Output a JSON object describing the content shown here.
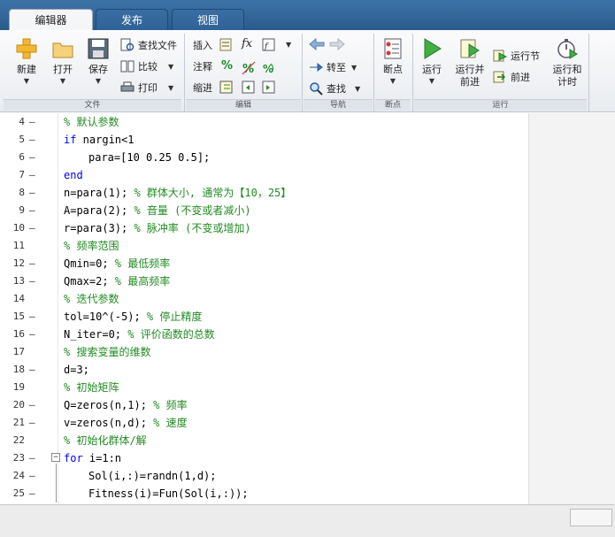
{
  "tabs": [
    {
      "label": "编辑器"
    },
    {
      "label": "发布"
    },
    {
      "label": "视图"
    }
  ],
  "toolstrip": {
    "file": {
      "section_label": "文件",
      "new_label": "新建",
      "open_label": "打开",
      "save_label": "保存",
      "find_files_label": "查找文件",
      "compare_label": "比较",
      "print_label": "打印"
    },
    "edit": {
      "section_label": "编辑",
      "insert_label": "插入",
      "comment_label": "注释",
      "indent_label": "缩进",
      "fx_label": "fx",
      "percent_label": "%"
    },
    "navigate": {
      "section_label": "导航",
      "goto_label": "转至",
      "find_label": "查找"
    },
    "breakpoints": {
      "section_label": "断点",
      "breakpoints_label": "断点"
    },
    "run": {
      "section_label": "运行",
      "run_label": "运行",
      "run_advance_label_1": "运行并",
      "run_advance_label_2": "前进",
      "run_section_label": "运行节",
      "advance_label": "前进",
      "run_time_label_1": "运行和",
      "run_time_label_2": "计时"
    }
  },
  "code_lines": [
    {
      "num": "4",
      "dash": "–",
      "indent": 1,
      "parts": [
        {
          "t": "% 默认参数",
          "c": "cm"
        }
      ]
    },
    {
      "num": "5",
      "dash": "–",
      "indent": 1,
      "parts": [
        {
          "t": "if",
          "c": "kw"
        },
        {
          "t": " nargin<1",
          "c": ""
        }
      ]
    },
    {
      "num": "6",
      "dash": "–",
      "indent": 2,
      "parts": [
        {
          "t": "para=[10 0.25 0.5];",
          "c": ""
        }
      ]
    },
    {
      "num": "7",
      "dash": "–",
      "indent": 1,
      "parts": [
        {
          "t": "end",
          "c": "kw"
        }
      ]
    },
    {
      "num": "8",
      "dash": "–",
      "indent": 1,
      "parts": [
        {
          "t": "n=para(1); ",
          "c": ""
        },
        {
          "t": "% 群体大小, 通常为【10，25】",
          "c": "cm"
        }
      ]
    },
    {
      "num": "9",
      "dash": "–",
      "indent": 1,
      "parts": [
        {
          "t": "A=para(2); ",
          "c": ""
        },
        {
          "t": "% 音量 (不变或者减小)",
          "c": "cm"
        }
      ]
    },
    {
      "num": "10",
      "dash": "–",
      "indent": 1,
      "parts": [
        {
          "t": "r=para(3); ",
          "c": ""
        },
        {
          "t": "% 脉冲率 (不变或增加)",
          "c": "cm"
        }
      ]
    },
    {
      "num": "11",
      "dash": "",
      "indent": 1,
      "parts": [
        {
          "t": "% 频率范围",
          "c": "cm"
        }
      ]
    },
    {
      "num": "12",
      "dash": "–",
      "indent": 1,
      "parts": [
        {
          "t": "Qmin=0; ",
          "c": ""
        },
        {
          "t": "% 最低频率",
          "c": "cm"
        }
      ]
    },
    {
      "num": "13",
      "dash": "–",
      "indent": 1,
      "parts": [
        {
          "t": "Qmax=2; ",
          "c": ""
        },
        {
          "t": "% 最高频率",
          "c": "cm"
        }
      ]
    },
    {
      "num": "14",
      "dash": "",
      "indent": 1,
      "parts": [
        {
          "t": "% 迭代参数",
          "c": "cm"
        }
      ]
    },
    {
      "num": "15",
      "dash": "–",
      "indent": 1,
      "parts": [
        {
          "t": "tol=10^(-5); ",
          "c": ""
        },
        {
          "t": "% 停止精度",
          "c": "cm"
        }
      ]
    },
    {
      "num": "16",
      "dash": "–",
      "indent": 1,
      "parts": [
        {
          "t": "N_iter=0; ",
          "c": ""
        },
        {
          "t": "% 评价函数的总数",
          "c": "cm"
        }
      ]
    },
    {
      "num": "17",
      "dash": "",
      "indent": 1,
      "parts": [
        {
          "t": "% 搜索变量的维数",
          "c": "cm"
        }
      ]
    },
    {
      "num": "18",
      "dash": "–",
      "indent": 1,
      "parts": [
        {
          "t": "d=3;",
          "c": ""
        }
      ]
    },
    {
      "num": "19",
      "dash": "",
      "indent": 1,
      "parts": [
        {
          "t": "% 初始矩阵",
          "c": "cm"
        }
      ]
    },
    {
      "num": "20",
      "dash": "–",
      "indent": 1,
      "parts": [
        {
          "t": "Q=zeros(n,1); ",
          "c": ""
        },
        {
          "t": "% 频率",
          "c": "cm"
        }
      ]
    },
    {
      "num": "21",
      "dash": "–",
      "indent": 1,
      "parts": [
        {
          "t": "v=zeros(n,d); ",
          "c": ""
        },
        {
          "t": "% 速度",
          "c": "cm"
        }
      ]
    },
    {
      "num": "22",
      "dash": "",
      "indent": 1,
      "parts": [
        {
          "t": "% 初始化群体/解",
          "c": "cm"
        }
      ]
    },
    {
      "num": "23",
      "dash": "–",
      "indent": 1,
      "fold": "−",
      "parts": [
        {
          "t": "for",
          "c": "kw"
        },
        {
          "t": " i=1:n",
          "c": ""
        }
      ]
    },
    {
      "num": "24",
      "dash": "–",
      "indent": 2,
      "parts": [
        {
          "t": "Sol(i,:)=randn(1,d);",
          "c": ""
        }
      ]
    },
    {
      "num": "25",
      "dash": "–",
      "indent": 2,
      "parts": [
        {
          "t": "Fitness(i)=Fun(Sol(i,:));",
          "c": ""
        }
      ]
    }
  ],
  "colors": {
    "keyword": "#0000ff",
    "comment": "#228b22",
    "tab_bar": "#2f6297"
  }
}
